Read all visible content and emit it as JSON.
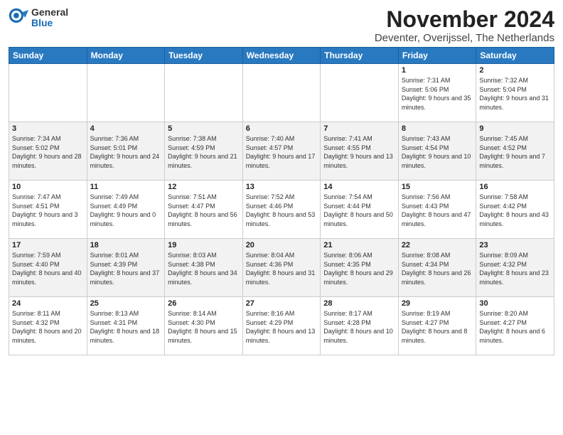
{
  "logo": {
    "general": "General",
    "blue": "Blue"
  },
  "title": "November 2024",
  "location": "Deventer, Overijssel, The Netherlands",
  "days_header": [
    "Sunday",
    "Monday",
    "Tuesday",
    "Wednesday",
    "Thursday",
    "Friday",
    "Saturday"
  ],
  "weeks": [
    [
      {
        "day": "",
        "info": ""
      },
      {
        "day": "",
        "info": ""
      },
      {
        "day": "",
        "info": ""
      },
      {
        "day": "",
        "info": ""
      },
      {
        "day": "",
        "info": ""
      },
      {
        "day": "1",
        "info": "Sunrise: 7:31 AM\nSunset: 5:06 PM\nDaylight: 9 hours and 35 minutes."
      },
      {
        "day": "2",
        "info": "Sunrise: 7:32 AM\nSunset: 5:04 PM\nDaylight: 9 hours and 31 minutes."
      }
    ],
    [
      {
        "day": "3",
        "info": "Sunrise: 7:34 AM\nSunset: 5:02 PM\nDaylight: 9 hours and 28 minutes."
      },
      {
        "day": "4",
        "info": "Sunrise: 7:36 AM\nSunset: 5:01 PM\nDaylight: 9 hours and 24 minutes."
      },
      {
        "day": "5",
        "info": "Sunrise: 7:38 AM\nSunset: 4:59 PM\nDaylight: 9 hours and 21 minutes."
      },
      {
        "day": "6",
        "info": "Sunrise: 7:40 AM\nSunset: 4:57 PM\nDaylight: 9 hours and 17 minutes."
      },
      {
        "day": "7",
        "info": "Sunrise: 7:41 AM\nSunset: 4:55 PM\nDaylight: 9 hours and 13 minutes."
      },
      {
        "day": "8",
        "info": "Sunrise: 7:43 AM\nSunset: 4:54 PM\nDaylight: 9 hours and 10 minutes."
      },
      {
        "day": "9",
        "info": "Sunrise: 7:45 AM\nSunset: 4:52 PM\nDaylight: 9 hours and 7 minutes."
      }
    ],
    [
      {
        "day": "10",
        "info": "Sunrise: 7:47 AM\nSunset: 4:51 PM\nDaylight: 9 hours and 3 minutes."
      },
      {
        "day": "11",
        "info": "Sunrise: 7:49 AM\nSunset: 4:49 PM\nDaylight: 9 hours and 0 minutes."
      },
      {
        "day": "12",
        "info": "Sunrise: 7:51 AM\nSunset: 4:47 PM\nDaylight: 8 hours and 56 minutes."
      },
      {
        "day": "13",
        "info": "Sunrise: 7:52 AM\nSunset: 4:46 PM\nDaylight: 8 hours and 53 minutes."
      },
      {
        "day": "14",
        "info": "Sunrise: 7:54 AM\nSunset: 4:44 PM\nDaylight: 8 hours and 50 minutes."
      },
      {
        "day": "15",
        "info": "Sunrise: 7:56 AM\nSunset: 4:43 PM\nDaylight: 8 hours and 47 minutes."
      },
      {
        "day": "16",
        "info": "Sunrise: 7:58 AM\nSunset: 4:42 PM\nDaylight: 8 hours and 43 minutes."
      }
    ],
    [
      {
        "day": "17",
        "info": "Sunrise: 7:59 AM\nSunset: 4:40 PM\nDaylight: 8 hours and 40 minutes."
      },
      {
        "day": "18",
        "info": "Sunrise: 8:01 AM\nSunset: 4:39 PM\nDaylight: 8 hours and 37 minutes."
      },
      {
        "day": "19",
        "info": "Sunrise: 8:03 AM\nSunset: 4:38 PM\nDaylight: 8 hours and 34 minutes."
      },
      {
        "day": "20",
        "info": "Sunrise: 8:04 AM\nSunset: 4:36 PM\nDaylight: 8 hours and 31 minutes."
      },
      {
        "day": "21",
        "info": "Sunrise: 8:06 AM\nSunset: 4:35 PM\nDaylight: 8 hours and 29 minutes."
      },
      {
        "day": "22",
        "info": "Sunrise: 8:08 AM\nSunset: 4:34 PM\nDaylight: 8 hours and 26 minutes."
      },
      {
        "day": "23",
        "info": "Sunrise: 8:09 AM\nSunset: 4:32 PM\nDaylight: 8 hours and 23 minutes."
      }
    ],
    [
      {
        "day": "24",
        "info": "Sunrise: 8:11 AM\nSunset: 4:32 PM\nDaylight: 8 hours and 20 minutes."
      },
      {
        "day": "25",
        "info": "Sunrise: 8:13 AM\nSunset: 4:31 PM\nDaylight: 8 hours and 18 minutes."
      },
      {
        "day": "26",
        "info": "Sunrise: 8:14 AM\nSunset: 4:30 PM\nDaylight: 8 hours and 15 minutes."
      },
      {
        "day": "27",
        "info": "Sunrise: 8:16 AM\nSunset: 4:29 PM\nDaylight: 8 hours and 13 minutes."
      },
      {
        "day": "28",
        "info": "Sunrise: 8:17 AM\nSunset: 4:28 PM\nDaylight: 8 hours and 10 minutes."
      },
      {
        "day": "29",
        "info": "Sunrise: 8:19 AM\nSunset: 4:27 PM\nDaylight: 8 hours and 8 minutes."
      },
      {
        "day": "30",
        "info": "Sunrise: 8:20 AM\nSunset: 4:27 PM\nDaylight: 8 hours and 6 minutes."
      }
    ]
  ]
}
